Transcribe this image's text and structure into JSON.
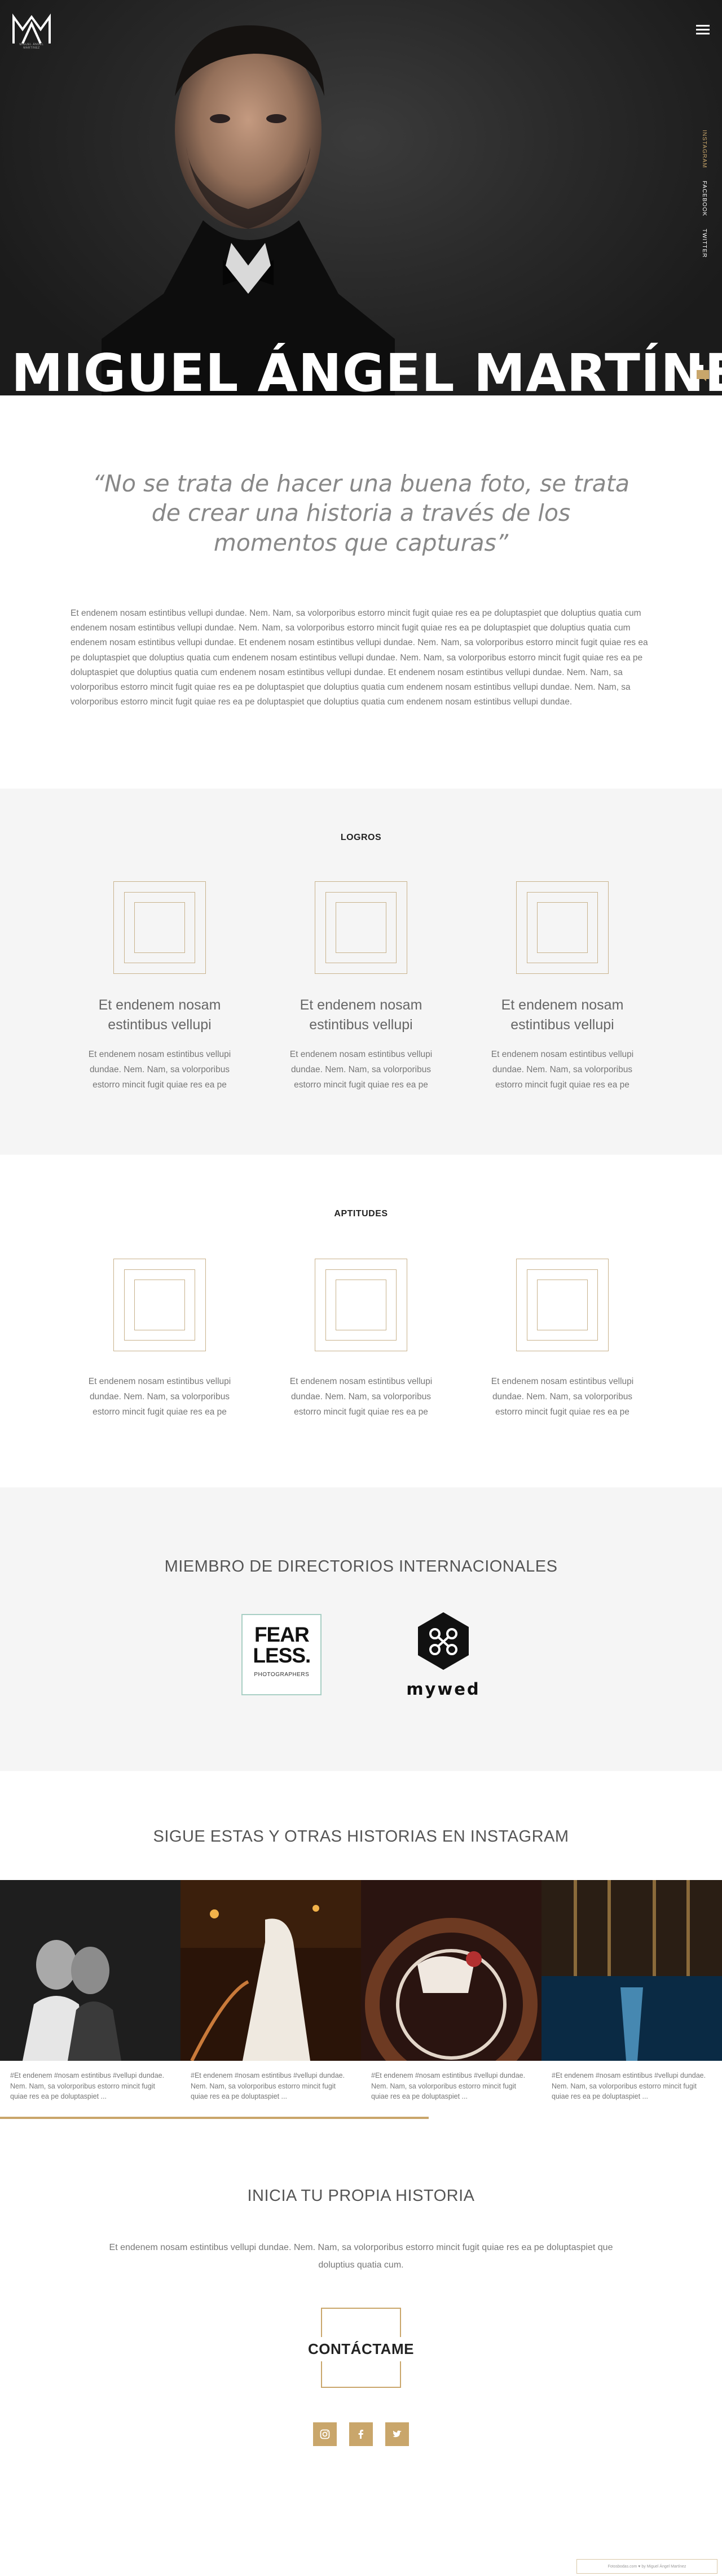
{
  "header": {
    "logo_text": "MIGUEL ÁNGEL MARTÍNEZ",
    "logo_initials": "M",
    "menu_icon": "hamburger-icon",
    "social": [
      "INSTAGRAM",
      "FACEBOOK",
      "TWITTER"
    ]
  },
  "hero": {
    "title": "MIGUEL ÁNGEL MARTÍNEZ",
    "chat_icon": "chat-icon"
  },
  "intro": {
    "quote": "“No se trata de hacer una buena foto, se trata de crear una historia a través de los momentos que capturas”",
    "text": "Et endenem nosam estintibus vellupi dundae. Nem. Nam, sa volorporibus estorro mincit fugit quiae res ea pe doluptaspiet que doluptius quatia cum endenem nosam estintibus vellupi dundae. Nem. Nam, sa volorporibus estorro mincit fugit quiae res ea pe doluptaspiet que doluptius quatia cum endenem nosam estintibus vellupi dundae. Et endenem nosam estintibus vellupi dundae. Nem. Nam, sa volorporibus estorro mincit fugit quiae res ea pe doluptaspiet que doluptius quatia cum endenem nosam estintibus vellupi dundae. Nem. Nam, sa volorporibus estorro mincit fugit quiae res ea pe doluptaspiet que doluptius quatia cum endenem nosam estintibus vellupi dundae. Et endenem nosam estintibus vellupi dundae. Nem. Nam, sa volorporibus estorro mincit fugit quiae res ea pe doluptaspiet que doluptius quatia cum endenem nosam estintibus vellupi dundae. Nem. Nam, sa volorporibus estorro mincit fugit quiae res ea pe doluptaspiet que doluptius quatia cum endenem nosam estintibus vellupi dundae."
  },
  "logros": {
    "title": "LOGROS",
    "items": [
      {
        "title": "Et endenem nosam estintibus vellupi",
        "text": "Et endenem nosam estintibus vellupi dundae. Nem. Nam, sa volorporibus estorro mincit fugit quiae res ea pe"
      },
      {
        "title": "Et endenem nosam estintibus vellupi",
        "text": "Et endenem nosam estintibus vellupi dundae. Nem. Nam, sa volorporibus estorro mincit fugit quiae res ea pe"
      },
      {
        "title": "Et endenem nosam estintibus vellupi",
        "text": "Et endenem nosam estintibus vellupi dundae. Nem. Nam, sa volorporibus estorro mincit fugit quiae res ea pe"
      }
    ]
  },
  "aptitudes": {
    "title": "APTITUDES",
    "items": [
      {
        "text": "Et endenem nosam estintibus vellupi dundae. Nem. Nam, sa volorporibus estorro mincit fugit quiae res ea pe"
      },
      {
        "text": "Et endenem nosam estintibus vellupi dundae. Nem. Nam, sa volorporibus estorro mincit fugit quiae res ea pe"
      },
      {
        "text": "Et endenem nosam estintibus vellupi dundae. Nem. Nam, sa volorporibus estorro mincit fugit quiae res ea pe"
      }
    ]
  },
  "directorios": {
    "title": "MIEMBRO DE DIRECTORIOS INTERNACIONALES",
    "fearless_line1": "FEAR",
    "fearless_line2": "LESS.",
    "fearless_sub": "PHOTOGRAPHERS",
    "mywed": "mywed"
  },
  "instagram": {
    "title": "SIGUE ESTAS Y OTRAS HISTORIAS EN INSTAGRAM",
    "posts": [
      {
        "caption": "#Et endenem #nosam estintibus #vellupi dundae. Nem. Nam, sa volorporibus estorro mincit fugit quiae res ea pe doluptaspiet ..."
      },
      {
        "caption": "#Et endenem #nosam estintibus #vellupi dundae. Nem. Nam, sa volorporibus estorro mincit fugit quiae res ea pe doluptaspiet ..."
      },
      {
        "caption": "#Et endenem #nosam estintibus #vellupi dundae. Nem. Nam, sa volorporibus estorro mincit fugit quiae res ea pe doluptaspiet ..."
      },
      {
        "caption": "#Et endenem #nosam estintibus #vellupi dundae. Nem. Nam, sa volorporibus estorro mincit fugit quiae res ea pe doluptaspiet ..."
      }
    ]
  },
  "cta": {
    "title": "INICIA TU PROPIA HISTORIA",
    "text": "Et endenem nosam estintibus vellupi dundae. Nem. Nam, sa volorporibus estorro mincit fugit quiae res ea pe doluptaspiet que doluptius quatia cum.",
    "button": "CONTÁCTAME",
    "social_icons": [
      "instagram-icon",
      "facebook-icon",
      "twitter-icon"
    ]
  },
  "footer": {
    "badge": "Fotosbodas.com ♥ by Miguel Ángel Martínez"
  },
  "colors": {
    "gold": "#c9a66b",
    "frame": "#c8b28c",
    "hero_bg": "#2a2a2a",
    "grey_section": "#f5f5f5"
  }
}
